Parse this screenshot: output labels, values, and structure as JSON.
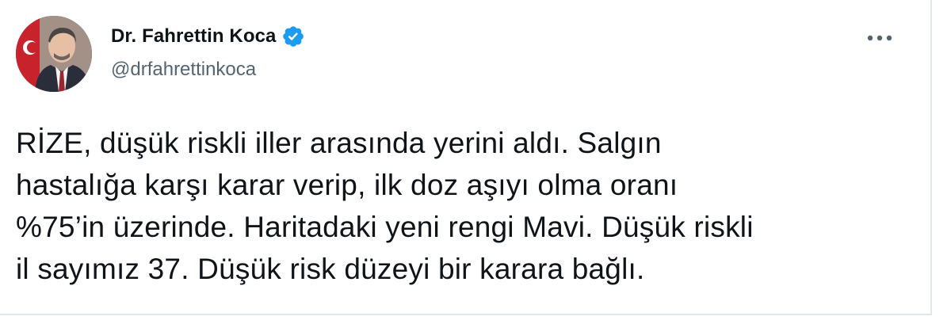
{
  "author": {
    "name": "Dr. Fahrettin Koca",
    "handle": "@drfahrettinkoca",
    "verified": true
  },
  "icons": {
    "verified": "verified-badge-icon",
    "more": "more-horizontal-icon"
  },
  "colors": {
    "verified_blue": "#1d9bf0",
    "text": "#0f1419",
    "secondary_text": "#536471"
  },
  "tweet": {
    "lines": [
      "RİZE, düşük riskli iller arasında yerini aldı. Salgın",
      "hastalığa karşı karar verip, ilk doz aşıyı olma oranı",
      "%75’in üzerinde. Haritadaki yeni rengi Mavi. Düşük riskli",
      "il sayımız 37. Düşük risk düzeyi bir karara bağlı."
    ]
  }
}
